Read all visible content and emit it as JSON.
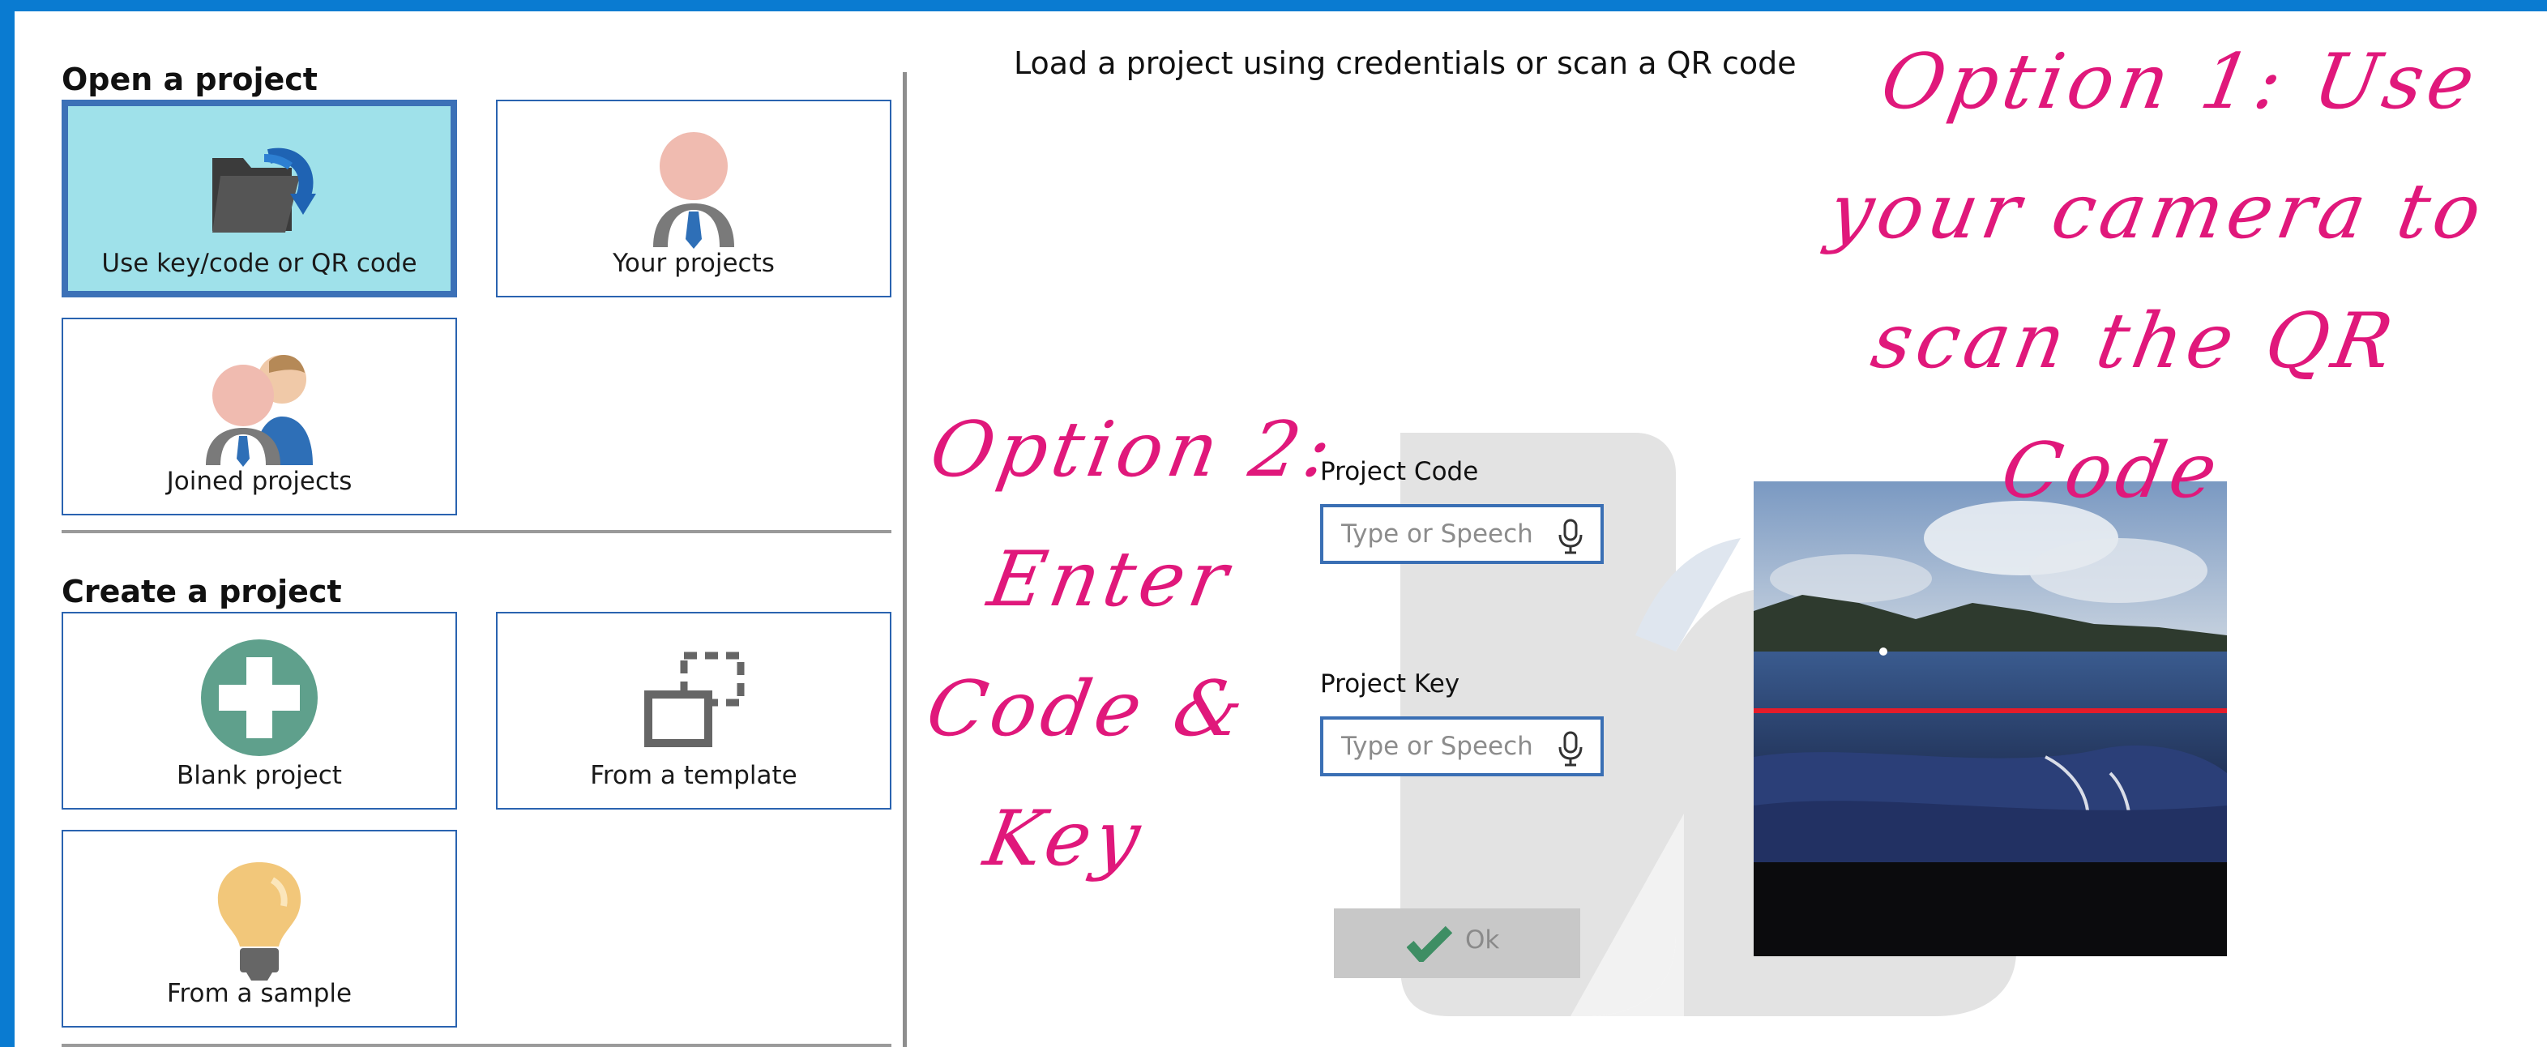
{
  "open_section": {
    "title": "Open a project",
    "tiles": [
      {
        "label": "Use key/code or QR code",
        "icon": "folder-refresh-icon",
        "selected": true
      },
      {
        "label": "Your projects",
        "icon": "user-icon"
      },
      {
        "label": "Joined projects",
        "icon": "users-icon"
      }
    ]
  },
  "create_section": {
    "title": "Create a project",
    "tiles": [
      {
        "label": "Blank project",
        "icon": "plus-circle-icon"
      },
      {
        "label": "From a template",
        "icon": "template-icon"
      },
      {
        "label": "From a sample",
        "icon": "lightbulb-icon"
      }
    ]
  },
  "load_panel": {
    "heading": "Load a project using credentials or scan a QR code",
    "project_code": {
      "label": "Project Code",
      "value": "",
      "placeholder": "Type or Speech"
    },
    "project_key": {
      "label": "Project Key",
      "value": "",
      "placeholder": "Type or Speech"
    },
    "ok_label": "Ok"
  },
  "annotations": {
    "option1": [
      "Option 1: Use",
      "your camera to",
      "scan the QR",
      "Code"
    ],
    "option2": [
      "Option 2:",
      "Enter",
      "Code &",
      "Key"
    ]
  },
  "colors": {
    "window_border": "#0a7bd1",
    "tile_border": "#2a63b0",
    "tile_selected_bg": "#9fe1ea",
    "annotation": "#e0187b",
    "scan_line": "#e51c2a",
    "ok_check": "#3e8e64"
  }
}
